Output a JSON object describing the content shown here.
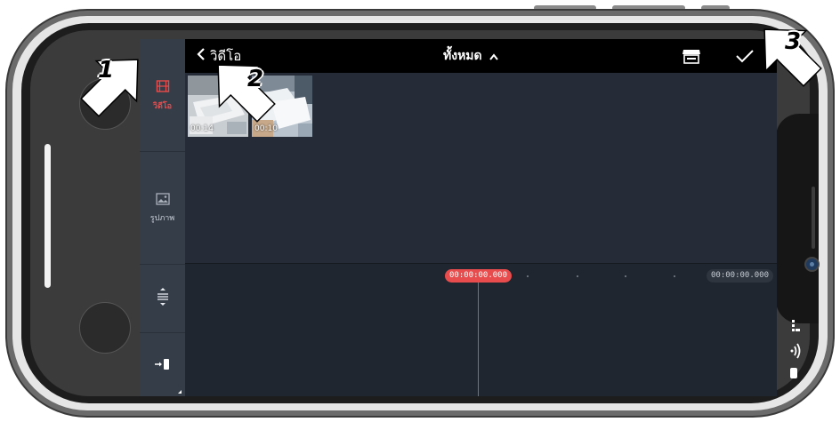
{
  "annotations": {
    "one": "1",
    "two": "2",
    "three": "3"
  },
  "sidebar": {
    "items": [
      {
        "label": "วิดีโอ",
        "icon": "film-icon",
        "active": true
      },
      {
        "label": "รูปภาพ",
        "icon": "image-icon",
        "active": false
      }
    ],
    "tools": [
      {
        "icon": "split-vertical-icon"
      },
      {
        "icon": "import-arrow-icon"
      }
    ]
  },
  "header": {
    "back_label": "วิดีโอ",
    "title": "ทั้งหมด",
    "store_icon": "store-icon",
    "confirm_icon": "checkmark-icon"
  },
  "media": {
    "items": [
      {
        "duration": "00:14"
      },
      {
        "duration": "00:10"
      }
    ]
  },
  "timeline": {
    "current_time": "00:00:00.000",
    "total_time": "00:00:00.000"
  },
  "colors": {
    "accent": "#e84c4c",
    "playhead": "#d94c3c",
    "timeline_bg": "#20262f",
    "media_bg": "#252c37",
    "sidebar_bg": "#353d49"
  }
}
